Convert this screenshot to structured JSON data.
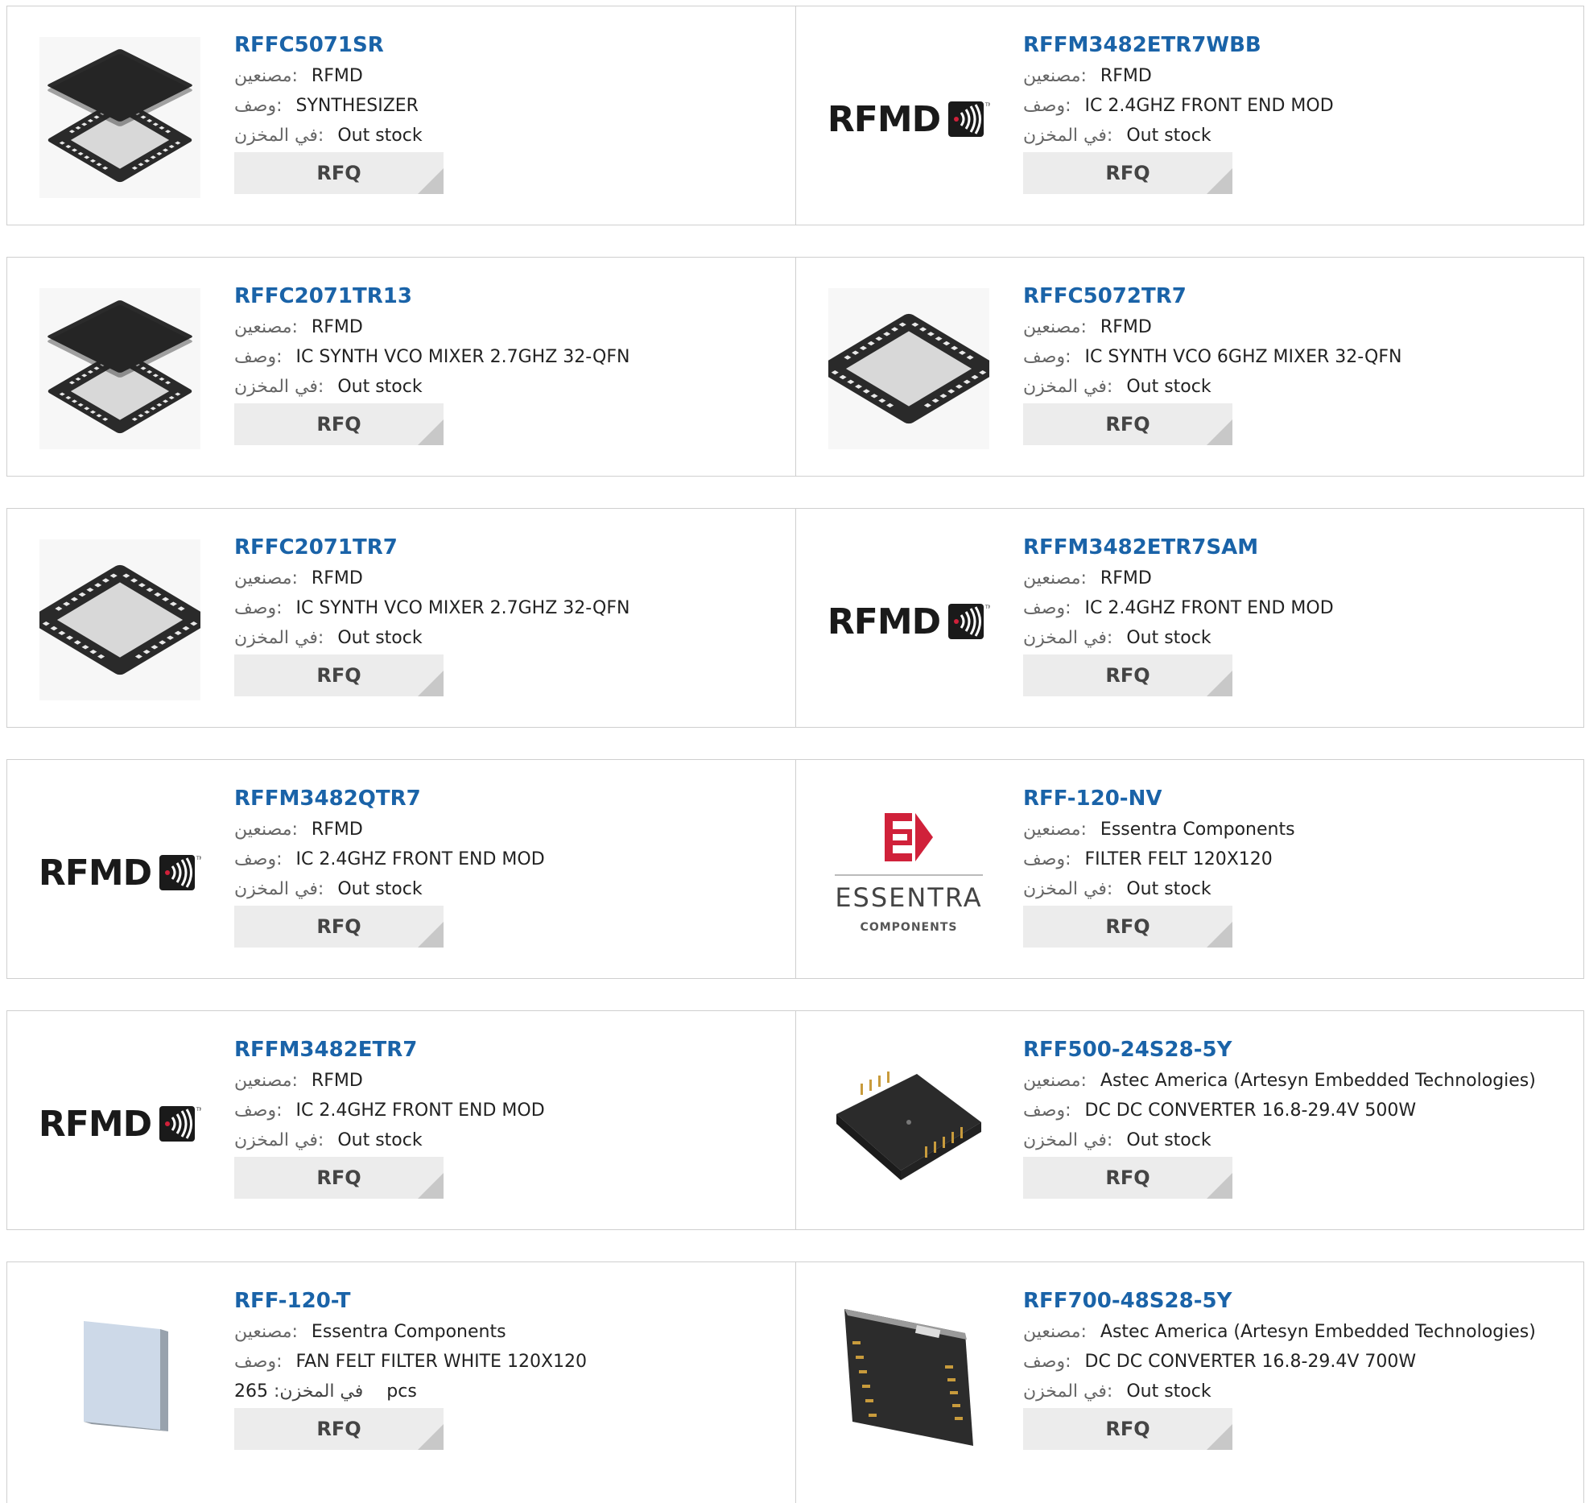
{
  "labels": {
    "manufacturer": "مصنعين:",
    "description": "وصف:",
    "stock": "في المخزن:",
    "rfq": "RFQ"
  },
  "products": [
    {
      "part": "RFFC5071SR",
      "manufacturer": "RFMD",
      "description": "SYNTHESIZER",
      "stock": "Out stock",
      "image": "qfn-chip-exploded"
    },
    {
      "part": "RFFM3482ETR7WBB",
      "manufacturer": "RFMD",
      "description": "IC 2.4GHZ FRONT END MOD",
      "stock": "Out stock",
      "image": "rfmd-logo",
      "logo_text": "RFMD"
    },
    {
      "part": "RFFC2071TR13",
      "manufacturer": "RFMD",
      "description": "IC SYNTH VCO MIXER 2.7GHZ 32-QFN",
      "stock": "Out stock",
      "image": "qfn-chip-exploded"
    },
    {
      "part": "RFFC5072TR7",
      "manufacturer": "RFMD",
      "description": "IC SYNTH VCO 6GHZ MIXER 32-QFN",
      "stock": "Out stock",
      "image": "qfn-chip"
    },
    {
      "part": "RFFC2071TR7",
      "manufacturer": "RFMD",
      "description": "IC SYNTH VCO MIXER 2.7GHZ 32-QFN",
      "stock": "Out stock",
      "image": "qfn-chip"
    },
    {
      "part": "RFFM3482ETR7SAM",
      "manufacturer": "RFMD",
      "description": "IC 2.4GHZ FRONT END MOD",
      "stock": "Out stock",
      "image": "rfmd-logo",
      "logo_text": "RFMD"
    },
    {
      "part": "RFFM3482QTR7",
      "manufacturer": "RFMD",
      "description": "IC 2.4GHZ FRONT END MOD",
      "stock": "Out stock",
      "image": "rfmd-logo",
      "logo_text": "RFMD"
    },
    {
      "part": "RFF-120-NV",
      "manufacturer": "Essentra Components",
      "description": "FILTER FELT 120X120",
      "stock": "Out stock",
      "image": "essentra-logo",
      "logo_text": "ESSENTRA",
      "logo_sub": "COMPONENTS"
    },
    {
      "part": "RFFM3482ETR7",
      "manufacturer": "RFMD",
      "description": "IC 2.4GHZ FRONT END MOD",
      "stock": "Out stock",
      "image": "rfmd-logo",
      "logo_text": "RFMD"
    },
    {
      "part": "RFF500-24S28-5Y",
      "manufacturer": "Astec America (Artesyn Embedded Technologies)",
      "description": "DC DC CONVERTER 16.8-29.4V 500W",
      "stock": "Out stock",
      "image": "dc-converter-brick"
    },
    {
      "part": "RFF-120-T",
      "manufacturer": "Essentra Components",
      "description": "FAN FELT FILTER WHITE 120X120",
      "stock": "265",
      "stock_unit": "pcs",
      "image": "felt-filter-pad"
    },
    {
      "part": "RFF700-48S28-5Y",
      "manufacturer": "Astec America (Artesyn Embedded Technologies)",
      "description": "DC DC CONVERTER 16.8-29.4V 700W",
      "stock": "Out stock",
      "image": "dc-converter-brick-large"
    }
  ],
  "colors": {
    "link": "#1a63a8",
    "label": "#666666",
    "rfq_bg": "#ececec",
    "rfq_corner": "#c8c8c8",
    "border": "#cfcfcf",
    "essentra_red": "#d0213a"
  }
}
